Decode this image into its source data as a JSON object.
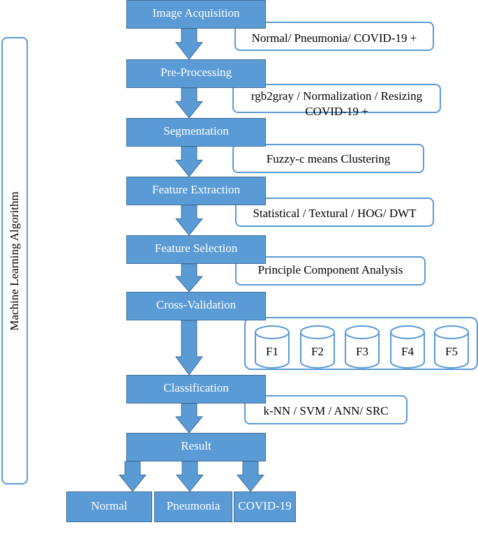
{
  "colors": {
    "box_fill": "#5b9bd5",
    "box_border": "#41719c",
    "outline": "#5b9bd5"
  },
  "side_label": "Machine Learning Algorithm",
  "steps": [
    "Image Acquisition",
    "Pre-Processing",
    "Segmentation",
    "Feature Extraction",
    "Feature Selection",
    "Cross-Validation",
    "Classification",
    "Result"
  ],
  "notes": {
    "acquisition": "Normal/ Pneumonia/ COVID-19 +",
    "preprocessing_line1": "rgb2gray / Normalization / Resizing",
    "preprocessing_line2": "COVID-19 +",
    "segmentation": "Fuzzy-c means Clustering",
    "extraction": "Statistical / Textural / HOG/ DWT",
    "selection": "Principle Component Analysis",
    "classification": "k-NN / SVM / ANN/ SRC"
  },
  "folds": [
    "F1",
    "F2",
    "F3",
    "F4",
    "F5"
  ],
  "outputs": [
    "Normal",
    "Pneumonia",
    "COVID-19 +"
  ]
}
